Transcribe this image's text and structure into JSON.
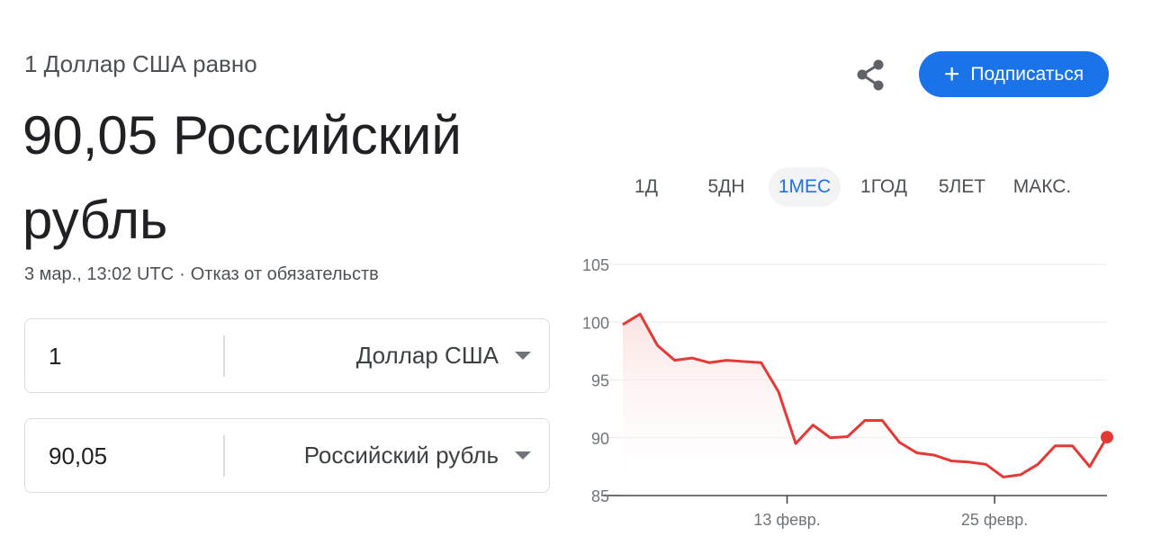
{
  "header": {
    "label": "1 Доллар США равно",
    "result": "90,05 Российский рубль"
  },
  "meta": {
    "timestamp": "3 мар., 13:02 UTC",
    "separator": "·",
    "disclaimer": "Отказ от обязательств"
  },
  "converter": {
    "from": {
      "amount": "1",
      "currency": "Доллар США"
    },
    "to": {
      "amount": "90,05",
      "currency": "Российский рубль"
    }
  },
  "actions": {
    "share_icon": "share-icon",
    "subscribe_label": "Подписаться",
    "subscribe_icon": "+"
  },
  "range_tabs": {
    "items": [
      "1Д",
      "5ДН",
      "1МЕС",
      "1ГОД",
      "5ЛЕТ",
      "МАКС."
    ],
    "active_index": 2
  },
  "colors": {
    "accent": "#1a73e8",
    "line": "#e53935",
    "fill": "#fbe3e2"
  },
  "chart_data": {
    "type": "area",
    "ylim": [
      85,
      105
    ],
    "y_ticks": [
      "105",
      "100",
      "95",
      "90",
      "85"
    ],
    "x_ticks": [
      "13 февр.",
      "25 февр."
    ],
    "values": [
      99.8,
      100.7,
      98.0,
      96.7,
      96.9,
      96.5,
      96.7,
      96.6,
      96.5,
      94.0,
      89.5,
      91.1,
      90.0,
      90.1,
      91.5,
      91.5,
      89.6,
      88.7,
      88.5,
      88.0,
      87.9,
      87.7,
      86.6,
      86.8,
      87.7,
      89.3,
      89.3,
      87.5,
      90.05
    ],
    "x_tick_positions": [
      9.5,
      21.5
    ],
    "grid": true
  }
}
